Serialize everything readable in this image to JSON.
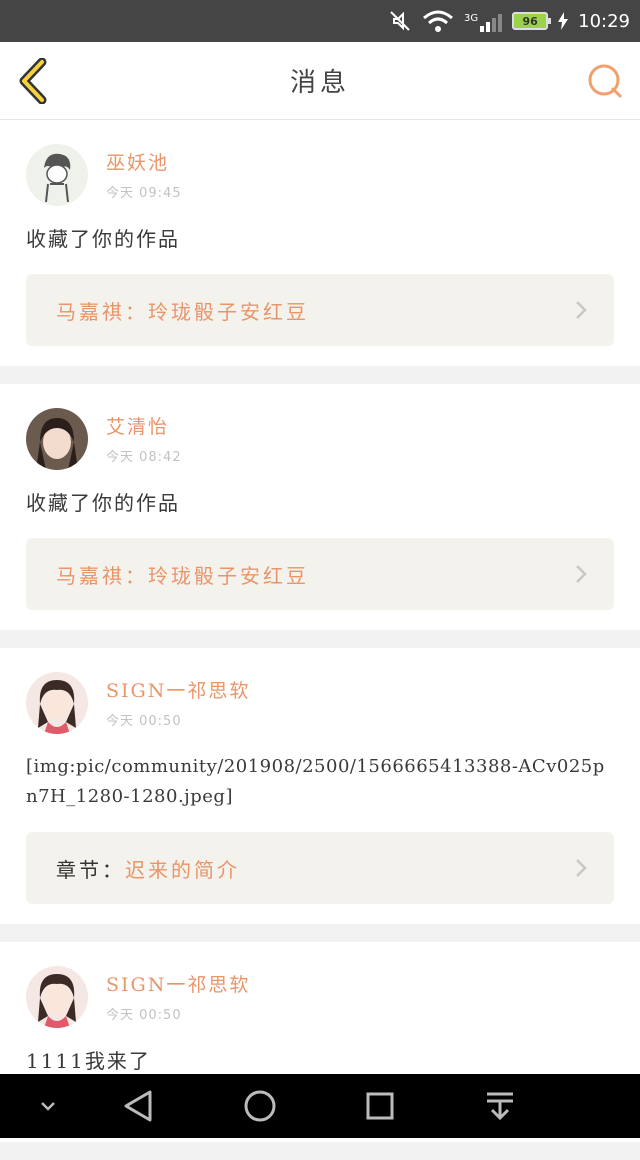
{
  "status_bar": {
    "time": "10:29",
    "battery": "96",
    "network": "3G"
  },
  "header": {
    "title": "消息"
  },
  "messages": [
    {
      "user": "巫妖池",
      "time": "今天 09:45",
      "action": "收藏了你的作品",
      "link_label": "马嘉祺：",
      "link_work": "玲珑骰子安红豆"
    },
    {
      "user": "艾清怡",
      "time": "今天 08:42",
      "action": "收藏了你的作品",
      "link_label": "马嘉祺：",
      "link_work": "玲珑骰子安红豆"
    },
    {
      "user": "SIGN一祁思软",
      "time": "今天 00:50",
      "action": "[img:pic/community/201908/2500/1566665413388-ACv025pn7H_1280-1280.jpeg]",
      "link_label": "章节：",
      "link_work": "迟来的简介"
    },
    {
      "user": "SIGN一祁思软",
      "time": "今天 00:50",
      "action": "1111我来了"
    }
  ],
  "colors": {
    "accent": "#e9956a",
    "link_bg": "#f4f2ec",
    "statusbar": "#454545"
  },
  "icons": {
    "back": "chevron-left-icon",
    "search": "search-icon",
    "nav": [
      "collapse-icon",
      "back-triangle-icon",
      "home-circle-icon",
      "recents-square-icon",
      "pull-down-icon"
    ]
  }
}
